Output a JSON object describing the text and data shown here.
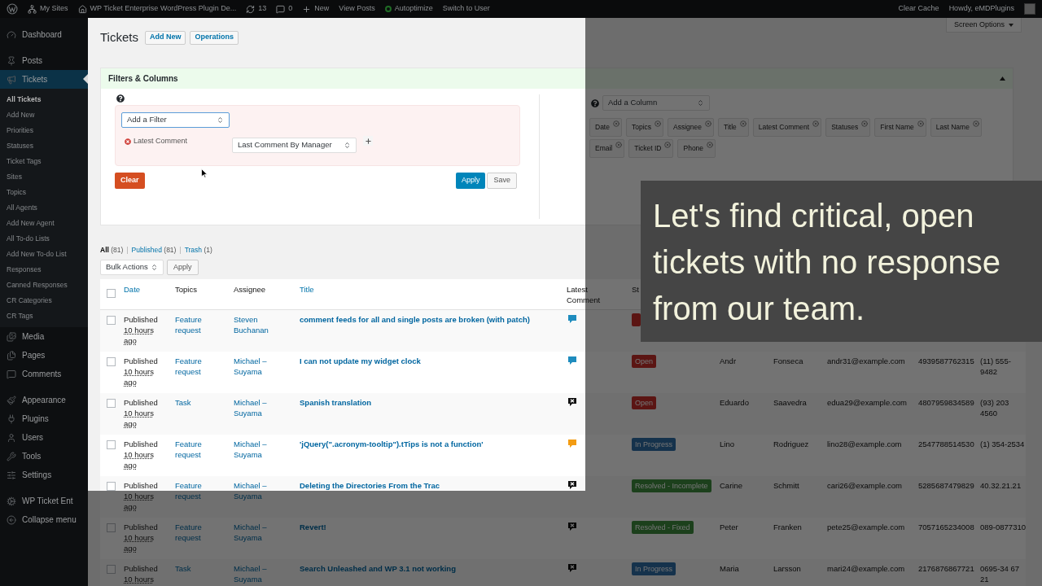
{
  "admin_bar": {
    "items": [
      {
        "kind": "sites",
        "label": "My Sites"
      },
      {
        "kind": "home",
        "label": "WP Ticket Enterprise WordPress Plugin De..."
      },
      {
        "kind": "updates",
        "label": "13"
      },
      {
        "kind": "comments",
        "label": "0"
      },
      {
        "kind": "new",
        "label": "New"
      },
      {
        "kind": "text",
        "label": "View Posts"
      },
      {
        "kind": "status",
        "label": "Autoptimize"
      },
      {
        "kind": "text",
        "label": "Switch to User"
      }
    ],
    "right": [
      "Clear Cache",
      "Howdy, eMDPlugins"
    ]
  },
  "sidebar": {
    "groups": [
      [
        {
          "kind": "dashboard",
          "label": "Dashboard",
          "selected": false
        }
      ],
      [
        {
          "kind": "posts",
          "label": "Posts",
          "selected": false
        },
        {
          "kind": "tickets",
          "label": "Tickets",
          "selected": true,
          "children": [
            {
              "label": "All Tickets",
              "selected": true
            },
            {
              "label": "Add New",
              "selected": false
            },
            {
              "label": "Priorities",
              "selected": false
            },
            {
              "label": "Statuses",
              "selected": false
            },
            {
              "label": "Ticket Tags",
              "selected": false
            },
            {
              "label": "Sites",
              "selected": false
            },
            {
              "label": "Topics",
              "selected": false
            },
            {
              "label": "All Agents",
              "selected": false
            },
            {
              "label": "Add New Agent",
              "selected": false
            },
            {
              "label": "All To-do Lists",
              "selected": false
            },
            {
              "label": "Add New To-do List",
              "selected": false
            },
            {
              "label": "Responses",
              "selected": false
            },
            {
              "label": "Canned Responses",
              "selected": false
            },
            {
              "label": "CR Categories",
              "selected": false
            },
            {
              "label": "CR Tags",
              "selected": false
            }
          ]
        },
        {
          "kind": "media",
          "label": "Media",
          "selected": false
        },
        {
          "kind": "pages",
          "label": "Pages",
          "selected": false
        },
        {
          "kind": "comments",
          "label": "Comments",
          "selected": false
        }
      ],
      [
        {
          "kind": "appearance",
          "label": "Appearance",
          "selected": false
        },
        {
          "kind": "plugins",
          "label": "Plugins",
          "selected": false
        },
        {
          "kind": "users",
          "label": "Users",
          "selected": false
        },
        {
          "kind": "tools",
          "label": "Tools",
          "selected": false
        },
        {
          "kind": "settings",
          "label": "Settings",
          "selected": false
        }
      ],
      [
        {
          "kind": "plugin",
          "label": "WP Ticket Ent",
          "selected": false
        },
        {
          "kind": "collapse",
          "label": "Collapse menu",
          "selected": false
        }
      ]
    ]
  },
  "header": {
    "title": "Tickets",
    "buttons": [
      "Add New",
      "Operations"
    ],
    "screen_options": "Screen Options"
  },
  "filters_panel": {
    "title": "Filters & Columns",
    "expanded": true,
    "filter_select": "Add a Filter",
    "filters": [
      {
        "label": "Latest Comment",
        "value": "Last Comment By Manager"
      }
    ],
    "clear": "Clear",
    "apply": "Apply",
    "save": "Save",
    "column_select": "Add a Column",
    "columns": [
      [
        "Date",
        "Topics",
        "Assignee",
        "Title",
        "Latest Comment",
        "Statuses",
        "First Name",
        "Last Name"
      ],
      [
        "Email",
        "Ticket ID",
        "Phone"
      ]
    ]
  },
  "views": [
    {
      "label": "All",
      "count": "(81)",
      "selected": true
    },
    {
      "separator": "|",
      "label": "Published",
      "count": "(81)",
      "selected": false
    },
    {
      "separator": "|",
      "label": "Trash",
      "count": "(1)",
      "selected": false
    }
  ],
  "bulk_actions": {
    "select": "Bulk Actions",
    "apply": "Apply"
  },
  "table": {
    "select_all_checked": false,
    "columns": [
      {
        "label": "Date",
        "sortable": true
      },
      {
        "label": "Topics",
        "sortable": false
      },
      {
        "label": "Assignee",
        "sortable": false
      },
      {
        "label": "Title",
        "sortable": true
      },
      {
        "label": "Latest Comment",
        "sortable": false
      },
      {
        "label": "St",
        "sortable": false
      }
    ],
    "rows": [
      {
        "checked": false,
        "date_status": "Published",
        "date_time": "10 hours ago",
        "topic": "Feature request",
        "assignee": "Steven Buchanan",
        "title": "comment feeds for all and single posts are broken (with patch)",
        "latest_comment": {
          "kind": "bubble",
          "color": "#1e8cbe"
        },
        "status": {
          "kind": "open"
        }
      },
      {
        "checked": false,
        "date_status": "Published",
        "date_time": "10 hours ago",
        "topic": "Feature request",
        "assignee": "Michael – Suyama",
        "title": "I can not update my widget clock",
        "latest_comment": {
          "kind": "bubble",
          "color": "#1e8cbe"
        },
        "status": {
          "kind": "open",
          "label": "Open"
        },
        "first_name": "Andr",
        "last_name": "Fonseca",
        "email": "andr31@example.com",
        "ticket_id": "4939587762315",
        "phone": "(11) 555-9482"
      },
      {
        "checked": false,
        "date_status": "Published",
        "date_time": "10 hours ago",
        "topic": "Task",
        "assignee": "Michael – Suyama",
        "title": "Spanish translation",
        "latest_comment": {
          "kind": "none"
        },
        "status": {
          "kind": "open",
          "label": "Open"
        },
        "first_name": "Eduardo",
        "last_name": "Saavedra",
        "email": "edua29@example.com",
        "ticket_id": "4807959834589",
        "phone": "(93) 203 4560"
      },
      {
        "checked": false,
        "date_status": "Published",
        "date_time": "10 hours ago",
        "topic": "Feature request",
        "assignee": "Michael – Suyama",
        "title": "'jQuery(\".acronym-tooltip\").tTips is not a function'",
        "latest_comment": {
          "kind": "bubble",
          "color": "#f39c12"
        },
        "status": {
          "kind": "progress",
          "label": "In Progress"
        },
        "first_name": "Lino",
        "last_name": "Rodriguez",
        "email": "lino28@example.com",
        "ticket_id": "2547788514530",
        "phone": "(1) 354-2534"
      },
      {
        "checked": false,
        "date_status": "Published",
        "date_time": "10 hours ago",
        "topic": "Feature request",
        "assignee": "Michael – Suyama",
        "title": "Deleting the Directories From the Trac",
        "latest_comment": {
          "kind": "none"
        },
        "status": {
          "kind": "resolved",
          "label": "Resolved - Incomplete"
        },
        "first_name": "Carine",
        "last_name": "Schmitt",
        "email": "cari26@example.com",
        "ticket_id": "5285687479829",
        "phone": "40.32.21.21"
      },
      {
        "checked": false,
        "date_status": "Published",
        "date_time": "10 hours ago",
        "topic": "Feature request",
        "assignee": "Michael – Suyama",
        "title": "Revert!",
        "latest_comment": {
          "kind": "none"
        },
        "status": {
          "kind": "resolved",
          "label": "Resolved - Fixed"
        },
        "first_name": "Peter",
        "last_name": "Franken",
        "email": "pete25@example.com",
        "ticket_id": "7057165234008",
        "phone": "089-0877310"
      },
      {
        "checked": false,
        "date_status": "Published",
        "date_time": "10 hours",
        "topic": "Task",
        "assignee": "Michael – Suyama",
        "title": "Search Unleashed and WP 3.1 not working",
        "latest_comment": {
          "kind": "none"
        },
        "status": {
          "kind": "progress",
          "label": "In Progress"
        },
        "first_name": "Maria",
        "last_name": "Larsson",
        "email": "mari24@example.com",
        "ticket_id": "2176876867721",
        "phone": "0695-34 67 21"
      }
    ]
  },
  "caption": "Let's find critical, open tickets with no response from our team."
}
